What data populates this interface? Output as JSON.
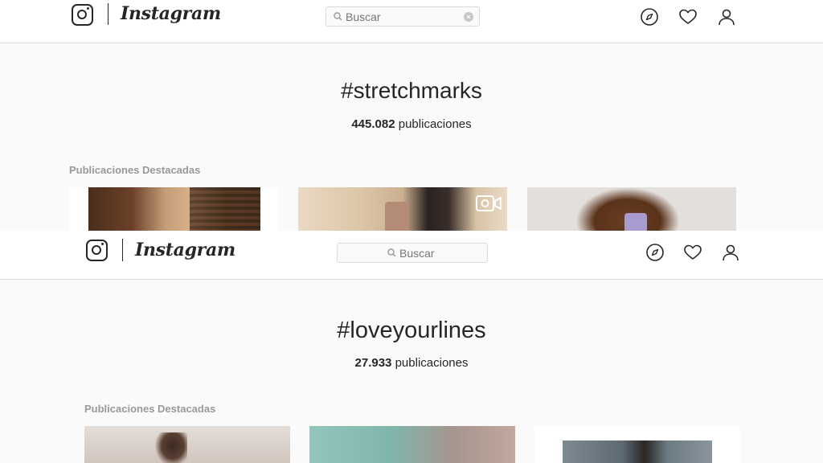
{
  "app": {
    "wordmark": "Instagram"
  },
  "icons": {
    "logo": "instagram-camera-icon",
    "search": "search-icon",
    "clear": "clear-icon",
    "explore": "compass-icon",
    "activity": "heart-icon",
    "profile": "user-icon"
  },
  "colors": {
    "text": "#262626",
    "muted": "#999999",
    "border": "#dbdbdb",
    "background": "#fafafa"
  },
  "top": {
    "search_placeholder": "Buscar",
    "hashtag": "#stretchmarks",
    "post_count": "445.082",
    "post_count_label": "publicaciones",
    "featured_label": "Publicaciones Destacadas"
  },
  "bottom": {
    "search_placeholder": "Buscar",
    "hashtag": "#loveyourlines",
    "post_count": "27.933",
    "post_count_label": "publicaciones",
    "featured_label": "Publicaciones Destacadas"
  }
}
